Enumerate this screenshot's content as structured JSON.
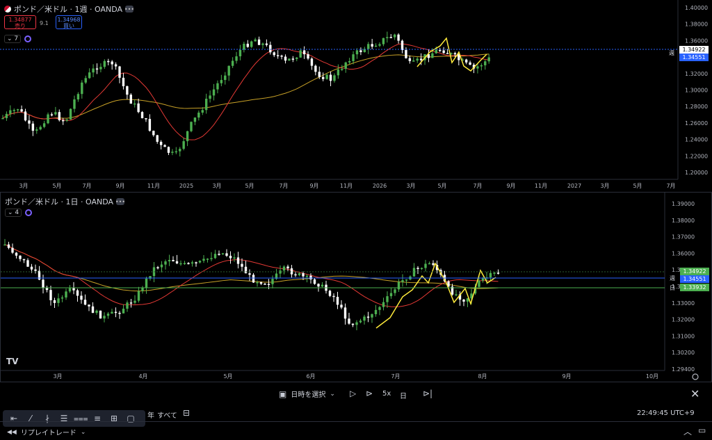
{
  "top": {
    "title": "ポンド／米ドル · 1週 · OANDA",
    "sell_price": "1.34877",
    "sell_label": "売り",
    "spread": "9.1",
    "buy_price": "1.34968",
    "buy_label": "買い",
    "indicator_count": "7",
    "y_ticks": [
      "1.40000",
      "1.38000",
      "1.36000",
      "1.34000",
      "1.32000",
      "1.30000",
      "1.28000",
      "1.26000",
      "1.24000",
      "1.22000",
      "1.20000"
    ],
    "x_ticks": [
      "3月",
      "5月",
      "7月",
      "9月",
      "11月",
      "2025",
      "3月",
      "5月",
      "7月",
      "9月",
      "11月",
      "2026",
      "3月",
      "5月",
      "7月",
      "9月",
      "11月",
      "2027",
      "3月",
      "5月",
      "7月"
    ],
    "price_tag": "1.34922",
    "week_tag": "1.34551",
    "week_label": "週"
  },
  "bottom": {
    "title": "ポンド／米ドル · 1日 · OANDA",
    "indicator_count": "4",
    "y_ticks": [
      "1.39000",
      "1.38000",
      "1.37000",
      "1.36000",
      "1.35000",
      "1.34000",
      "1.33000",
      "1.32000",
      "1.31000",
      "1.30200",
      "1.29400"
    ],
    "x_ticks": [
      "3月",
      "4月",
      "5月",
      "6月",
      "7月",
      "8月",
      "9月",
      "10月"
    ],
    "price_tag": "1.34922",
    "week_tag": "1.34551",
    "week_label": "週",
    "day_tag": "1.33932",
    "day_label": "日",
    "logo": "TV"
  },
  "replay": {
    "select_date": "日時を選択",
    "speed": "5x",
    "interval": "日",
    "range_year": "年",
    "range_all": "すべて",
    "clock": "22:49:45 UTC+9",
    "replay_trade": "リプレイトレード"
  },
  "colors": {
    "up": "#4caf50",
    "down": "#ffffff",
    "ma_short": "#e53935",
    "ma_long": "#c9a227",
    "zigzag": "#ffeb3b",
    "price_tag": "#4caf50",
    "week_tag": "#2962ff"
  }
}
